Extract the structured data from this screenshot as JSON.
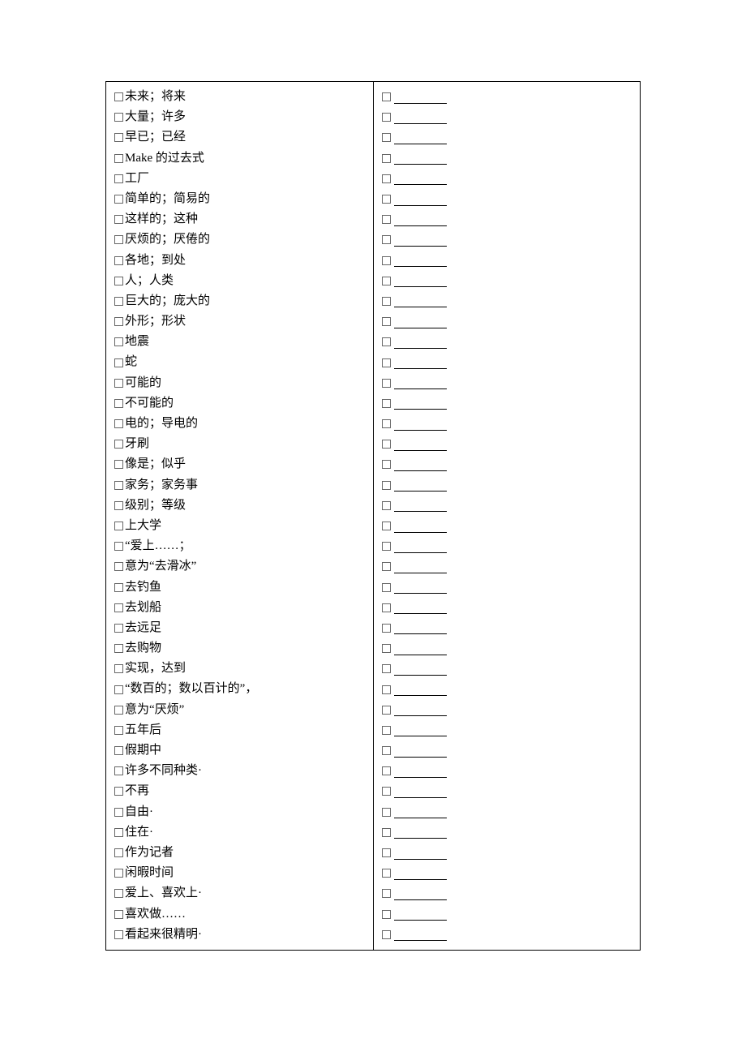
{
  "left_items": [
    "未来；将来",
    "大量；许多",
    "早已；已经",
    "Make 的过去式",
    "工厂",
    "简单的；简易的",
    "这样的；这种",
    "厌烦的；厌倦的",
    "各地；到处",
    "人；人类",
    "巨大的；庞大的",
    "外形；形状",
    "地震",
    "蛇",
    "可能的",
    "不可能的",
    "电的；导电的",
    "牙刷",
    "像是；似乎",
    "家务；家务事",
    "级别；等级",
    "上大学",
    "“爱上……；",
    "意为“去滑冰”",
    "去钓鱼",
    "去划船",
    "去远足",
    "去购物",
    "实现，达到",
    "“数百的；数以百计的”，",
    "意为“厌烦”",
    "五年后",
    "假期中",
    "许多不同种类·",
    "不再",
    "自由·",
    "住在·",
    "作为记者",
    "闲暇时间",
    "爱上、喜欢上·",
    "喜欢做……",
    "看起来很精明·"
  ],
  "right_count": 42
}
